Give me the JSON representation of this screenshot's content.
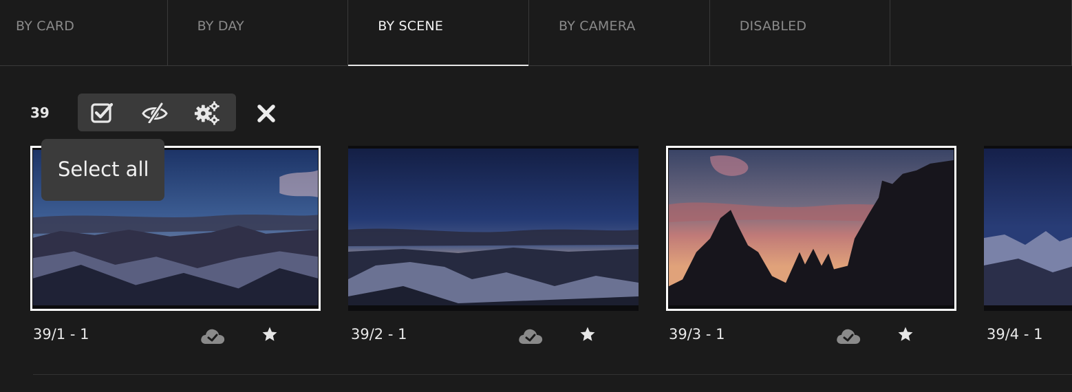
{
  "tabs": [
    {
      "label": "BY CARD",
      "active": false
    },
    {
      "label": "BY DAY",
      "active": false
    },
    {
      "label": "BY SCENE",
      "active": true
    },
    {
      "label": "BY CAMERA",
      "active": false
    },
    {
      "label": "DISABLED",
      "active": false
    }
  ],
  "selection": {
    "count": "39",
    "tools": [
      "select-all-icon",
      "eye-off-icon",
      "settings-icon"
    ],
    "close_icon": "close-icon"
  },
  "tooltip": {
    "text": "Select all"
  },
  "clips": [
    {
      "label": "39/1 - 1",
      "selected": true,
      "cloud_icon": "cloud-check-icon",
      "star_icon": "star-icon"
    },
    {
      "label": "39/2 - 1",
      "selected": false,
      "cloud_icon": "cloud-check-icon",
      "star_icon": "star-icon"
    },
    {
      "label": "39/3 - 1",
      "selected": true,
      "cloud_icon": "cloud-check-icon",
      "star_icon": "star-icon"
    },
    {
      "label": "39/4 - 1",
      "selected": false
    }
  ],
  "colors": {
    "background": "#1b1b1b",
    "toolbar": "#3a3a3a",
    "selection_border": "#ffffff",
    "icon_muted": "#8a8a8a"
  }
}
